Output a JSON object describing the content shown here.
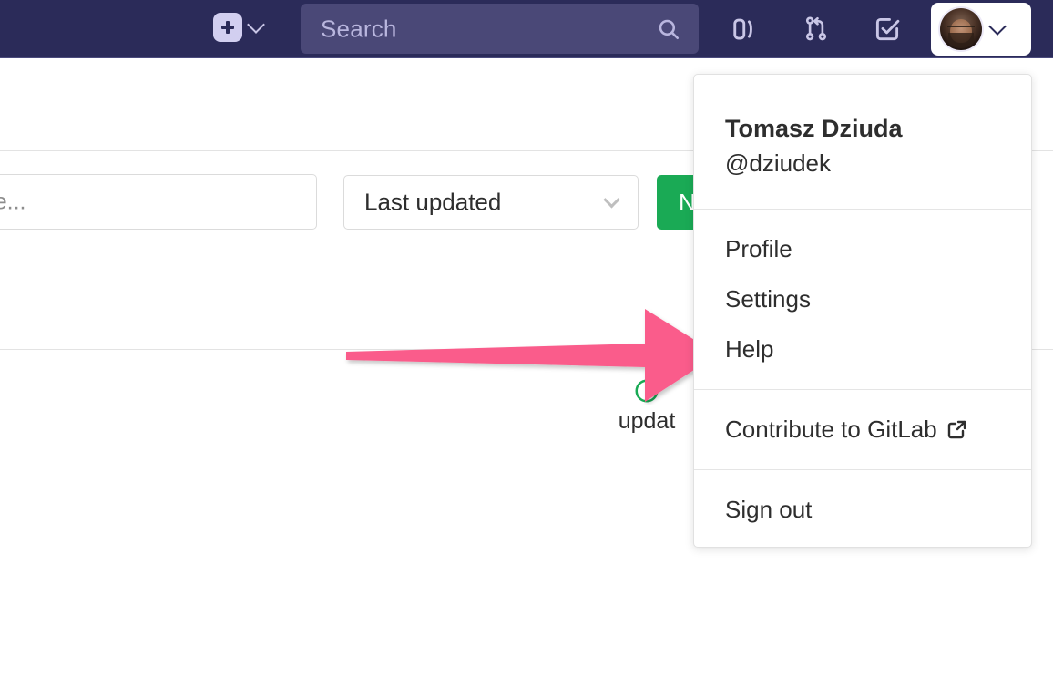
{
  "navbar": {
    "background_color": "#2b2b59",
    "create_new": {
      "icon": "plus-icon",
      "caret_icon": "chevron-down-icon"
    },
    "search": {
      "placeholder": "Search",
      "icon": "search-icon"
    },
    "icons": [
      {
        "name": "issues-icon",
        "title": "Issues"
      },
      {
        "name": "merge-requests-icon",
        "title": "Merge requests"
      },
      {
        "name": "todos-icon",
        "title": "To-Do List"
      }
    ],
    "user": {
      "avatar": "user-avatar",
      "caret_icon": "chevron-down-icon"
    }
  },
  "page": {
    "filter_input": {
      "placeholder": "ame...",
      "value": ""
    },
    "sort_select": {
      "value": "Last updated",
      "caret_icon": "chevron-down-icon"
    },
    "new_button": {
      "label": "N",
      "color": "#1aaa55"
    },
    "status": {
      "icon": "clock-icon",
      "icon_color": "#1aaa55",
      "text": "updat"
    }
  },
  "annotation": {
    "arrow": {
      "name": "pink-arrow",
      "color": "#fa5c8b",
      "points_to": "Settings",
      "direction": "right"
    }
  },
  "user_dropdown": {
    "name": "Tomasz Dziuda",
    "handle": "@dziudek",
    "groups": [
      {
        "items": [
          {
            "label": "Profile",
            "icon": null
          },
          {
            "label": "Settings",
            "icon": null
          },
          {
            "label": "Help",
            "icon": null
          }
        ]
      },
      {
        "items": [
          {
            "label": "Contribute to GitLab",
            "icon": "external-link-icon"
          }
        ]
      },
      {
        "items": [
          {
            "label": "Sign out",
            "icon": null
          }
        ]
      }
    ]
  }
}
